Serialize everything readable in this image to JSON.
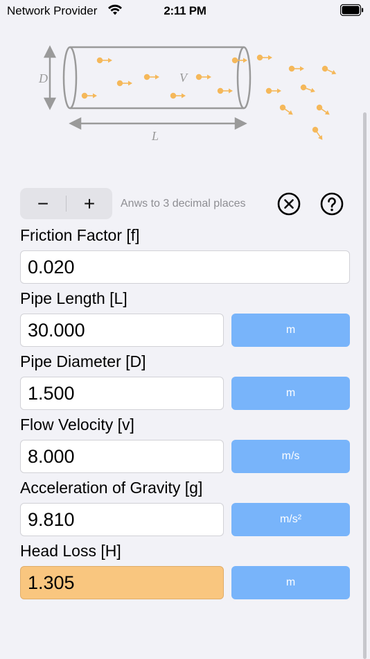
{
  "status_bar": {
    "carrier": "Network Provider",
    "time": "2:11 PM"
  },
  "diagram": {
    "label_diameter": "D",
    "label_velocity": "V",
    "label_length": "L",
    "pipe_color": "#999999",
    "particle_color": "#f5b85a"
  },
  "toolbar": {
    "decrease_label": "−",
    "increase_label": "+",
    "precision_note": "Anws to 3 decimal places"
  },
  "fields": {
    "friction": {
      "label": "Friction Factor [f]",
      "value": "0.020"
    },
    "length": {
      "label": "Pipe Length [L]",
      "value": "30.000",
      "unit": "m"
    },
    "diameter": {
      "label": "Pipe Diameter [D]",
      "value": "1.500",
      "unit": "m"
    },
    "velocity": {
      "label": "Flow Velocity [v]",
      "value": "8.000",
      "unit": "m/s"
    },
    "gravity": {
      "label": "Acceleration of Gravity [g]",
      "value": "9.810",
      "unit": "m/s²"
    },
    "head_loss": {
      "label": "Head Loss [H]",
      "value": "1.305",
      "unit": "m"
    }
  },
  "colors": {
    "unit_button": "#78b4fa",
    "result_field": "#f9c67f",
    "background": "#f2f2f7"
  }
}
